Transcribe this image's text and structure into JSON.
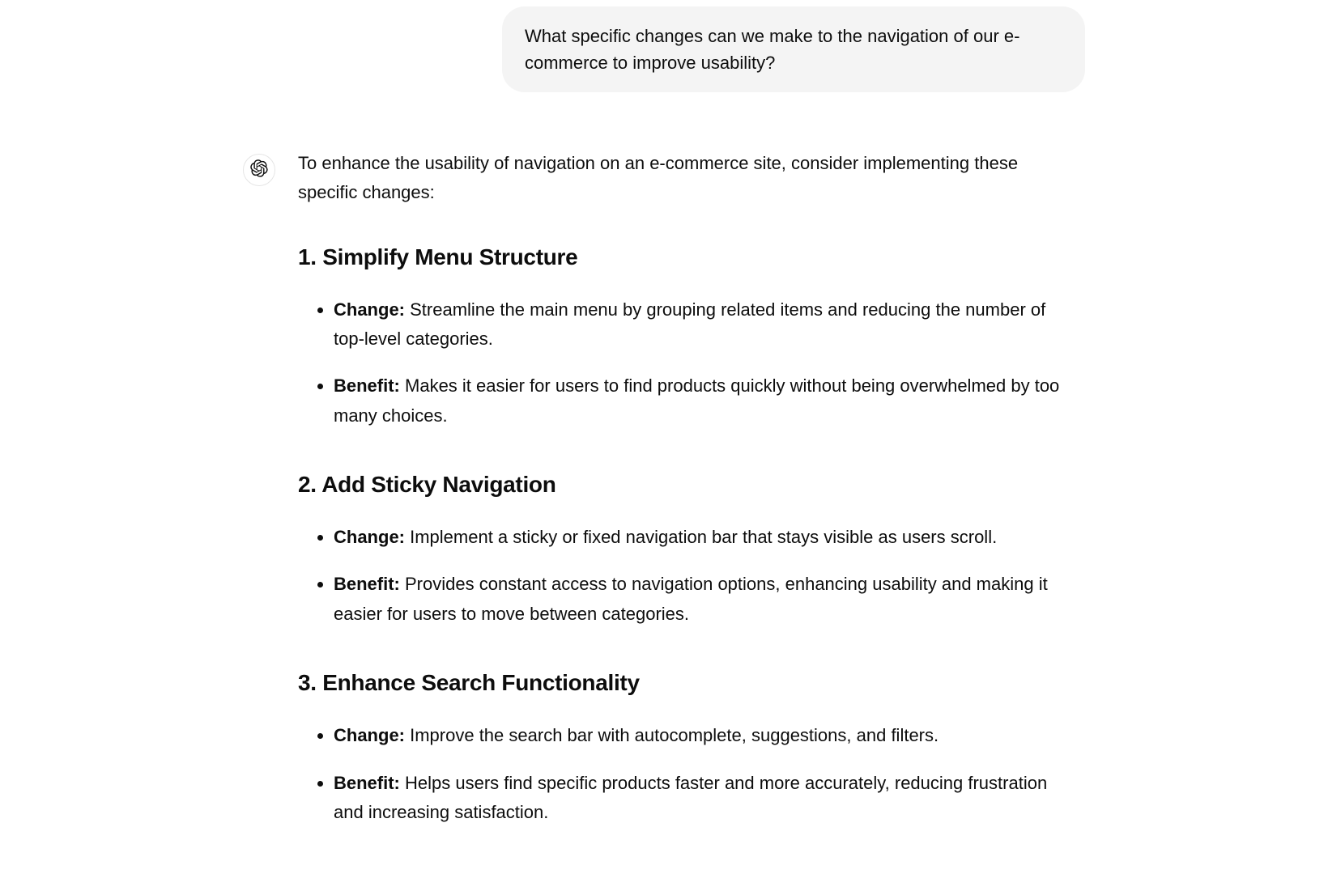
{
  "user_message": "What specific changes can we make to the navigation of our e-commerce to improve usability?",
  "assistant": {
    "intro": "To enhance the usability of navigation on an e-commerce site, consider implementing these specific changes:",
    "sections": [
      {
        "number": "1.",
        "title": "Simplify Menu Structure",
        "items": [
          {
            "label": "Change:",
            "text": " Streamline the main menu by grouping related items and reducing the number of top-level categories."
          },
          {
            "label": "Benefit:",
            "text": " Makes it easier for users to find products quickly without being overwhelmed by too many choices."
          }
        ]
      },
      {
        "number": "2.",
        "title": "Add Sticky Navigation",
        "items": [
          {
            "label": "Change:",
            "text": " Implement a sticky or fixed navigation bar that stays visible as users scroll."
          },
          {
            "label": "Benefit:",
            "text": " Provides constant access to navigation options, enhancing usability and making it easier for users to move between categories."
          }
        ]
      },
      {
        "number": "3.",
        "title": "Enhance Search Functionality",
        "items": [
          {
            "label": "Change:",
            "text": " Improve the search bar with autocomplete, suggestions, and filters."
          },
          {
            "label": "Benefit:",
            "text": " Helps users find specific products faster and more accurately, reducing frustration and increasing satisfaction."
          }
        ]
      }
    ]
  }
}
